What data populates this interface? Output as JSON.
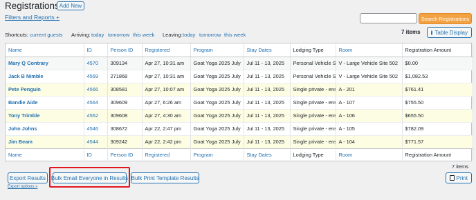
{
  "header": {
    "title": "Registrations",
    "add_new": "Add New",
    "filters_link": "Filters and Reports +"
  },
  "search": {
    "placeholder": "",
    "button": "Search Registrations"
  },
  "shortcuts": {
    "label": "Shortcuts:",
    "current_guests": "current guests",
    "arriving_label": "Arriving:",
    "arriving": [
      "today",
      "tomorrow",
      "this week"
    ],
    "leaving_label": "Leaving:",
    "leaving": [
      "today",
      "tomorrow",
      "this week"
    ]
  },
  "items_count": "7 items",
  "table_display": "Table Display",
  "table": {
    "columns": [
      "Name",
      "ID",
      "Person ID",
      "Registered",
      "Program",
      "Stay Dates",
      "Lodging Type",
      "Room",
      "Registration Amount"
    ],
    "rows": [
      [
        "Mary Q Contrary",
        "4570",
        "309134",
        "Apr 27, 10:31 am",
        "Goat Yoga 2025 July",
        "Jul 11 - 13, 2025",
        "Personal Vehicle Sit",
        "V - Large Vehicle Site 502",
        "$0.00"
      ],
      [
        "Jack B Nimble",
        "4569",
        "271868",
        "Apr 27, 10:31 am",
        "Goat Yoga 2025 July",
        "Jul 11 - 13, 2025",
        "Personal Vehicle Sit",
        "V - Large Vehicle Site 502",
        "$1,082.53"
      ],
      [
        "Pete Penguin",
        "4566",
        "308581",
        "Apr 27, 10:07 am",
        "Goat Yoga 2025 July",
        "Jul 11 - 13, 2025",
        "Single private - ens",
        "A - 201",
        "$761.41"
      ],
      [
        "Bandie Aide",
        "4564",
        "309609",
        "Apr 27, 6:26 am",
        "Goat Yoga 2025 July",
        "Jul 11 - 13, 2025",
        "Single private - ens",
        "A - 107",
        "$755.50"
      ],
      [
        "Tony Trimble",
        "4562",
        "309608",
        "Apr 27, 4:30 am",
        "Goat Yoga 2025 July",
        "Jul 11 - 13, 2025",
        "Single private - ens",
        "A - 106",
        "$655.50"
      ],
      [
        "John Johns",
        "4546",
        "308672",
        "Apr 22, 2:47 pm",
        "Goat Yoga 2025 July",
        "Jul 11 - 13, 2025",
        "Single private - ens",
        "A - 105",
        "$782.09"
      ],
      [
        "Jim Beam",
        "4544",
        "309242",
        "Apr 22, 2:42 pm",
        "Goat Yoga 2025 July",
        "Jul 11 - 13, 2025",
        "Single private - ens",
        "A - 104",
        "$771.57"
      ]
    ]
  },
  "bottom_count": "7 items",
  "actions": {
    "export": "Export Results",
    "bulk_email": "Bulk Email Everyone in Results",
    "bulk_print": "Bulk Print Template Results",
    "print": "Print",
    "export_options": "Export options »"
  },
  "colors": {
    "accent": "#2271b1",
    "search_button": "#f3a243",
    "highlight": "#e0141e"
  }
}
